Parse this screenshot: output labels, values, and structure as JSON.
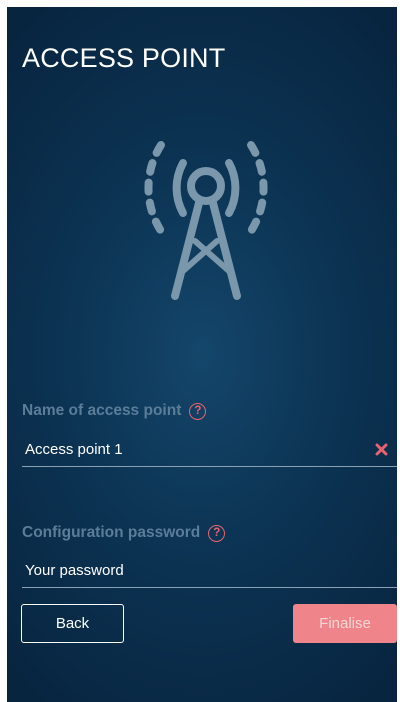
{
  "header": {
    "title": "ACCESS POINT"
  },
  "icons": {
    "hero": "radio-tower-icon",
    "help": "question-mark-circle-icon",
    "clear": "close-x-icon"
  },
  "fields": {
    "name": {
      "label": "Name of access point",
      "help_glyph": "?",
      "value": "Access point 1",
      "placeholder": ""
    },
    "password": {
      "label": "Configuration password",
      "help_glyph": "?",
      "value": "",
      "placeholder": "Your password"
    }
  },
  "buttons": {
    "back_label": "Back",
    "finalise_label": "Finalise"
  },
  "colors": {
    "background": "#0c3454",
    "accent": "#e8636d",
    "finalise_bg": "#ef858a",
    "label": "#5b7d99",
    "icon": "#7a97ab"
  }
}
